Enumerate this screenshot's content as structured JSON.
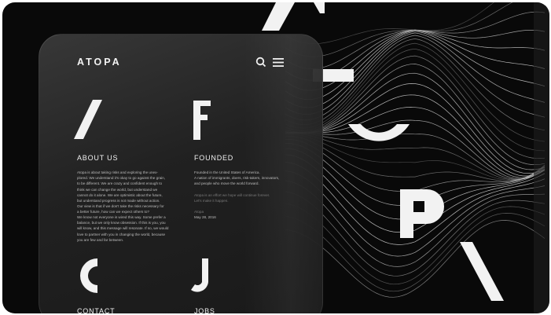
{
  "brand": {
    "logo": "ATOPA"
  },
  "header": {
    "icons": [
      "search-icon",
      "menu-icon"
    ]
  },
  "sections": {
    "about": {
      "title": "ABOUT US",
      "paragraph1": "Atopa is about taking risks and exploring the unex-\nplored. We understand it's okay to go against the grain,\nto be different. We are crazy and confident enough to\nthink we can change the world, but understand we\ncannot do it alone. We are optimistic about the future,\nbut understand progress is not made without action.\nOur view is that if we don't take the risks necessary for\na better future, how can we expect others to?",
      "paragraph2": "We know not everyone is wired this way. Some prefer a\nbalance, but we only know obsession. If this is you, you\nwill know, and this message will resonate. If so, we would\nlove to partner with you in changing the world, because\nyou are few and far between."
    },
    "founded": {
      "title": "FOUNDED",
      "paragraph1": "Founded in the United States of America.\nA nation of immigrants, doers, risk-takers, innovators,\nand people who move the world forward.",
      "paragraph2": "Atopa is an effort we hope will continue forever.\nLet's make it happen.",
      "author": "Atopa",
      "date": "May 28, 2016"
    },
    "contact": {
      "title": "CONTACT"
    },
    "jobs": {
      "title": "JOBS"
    }
  },
  "colors": {
    "background": "#090909",
    "card": "#2a2a2a",
    "text": "#f0f0f0",
    "muted": "#7a7a7a"
  }
}
